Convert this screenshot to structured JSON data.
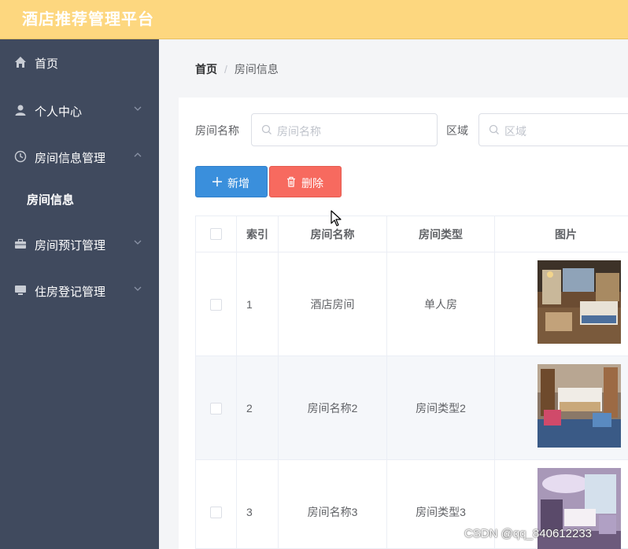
{
  "app": {
    "title": "酒店推荐管理平台"
  },
  "sidebar": {
    "items": [
      {
        "label": "首页",
        "icon": "home-icon"
      },
      {
        "label": "个人中心",
        "icon": "user-icon",
        "chevron": "down"
      },
      {
        "label": "房间信息管理",
        "icon": "clock-icon",
        "chevron": "up"
      },
      {
        "label": "房间预订管理",
        "icon": "briefcase-icon",
        "chevron": "down"
      },
      {
        "label": "住房登记管理",
        "icon": "monitor-icon",
        "chevron": "down"
      }
    ],
    "active_sub": "房间信息"
  },
  "breadcrumb": {
    "home": "首页",
    "separator": "/",
    "current": "房间信息"
  },
  "search": {
    "room_name_label": "房间名称",
    "room_name_placeholder": "房间名称",
    "area_label": "区域",
    "area_placeholder": "区域"
  },
  "toolbar": {
    "add_label": "新增",
    "delete_label": "删除"
  },
  "table": {
    "headers": {
      "index": "索引",
      "name": "房间名称",
      "type": "房间类型",
      "image": "图片"
    },
    "rows": [
      {
        "index": "1",
        "name": "酒店房间",
        "type": "单人房"
      },
      {
        "index": "2",
        "name": "房间名称2",
        "type": "房间类型2"
      },
      {
        "index": "3",
        "name": "房间名称3",
        "type": "房间类型3"
      }
    ]
  },
  "watermark": "CSDN @qq_840612233",
  "colors": {
    "header": "#fdd77f",
    "sidebar": "#404a5e",
    "primary": "#3a8fdc",
    "danger": "#f76a5f"
  }
}
